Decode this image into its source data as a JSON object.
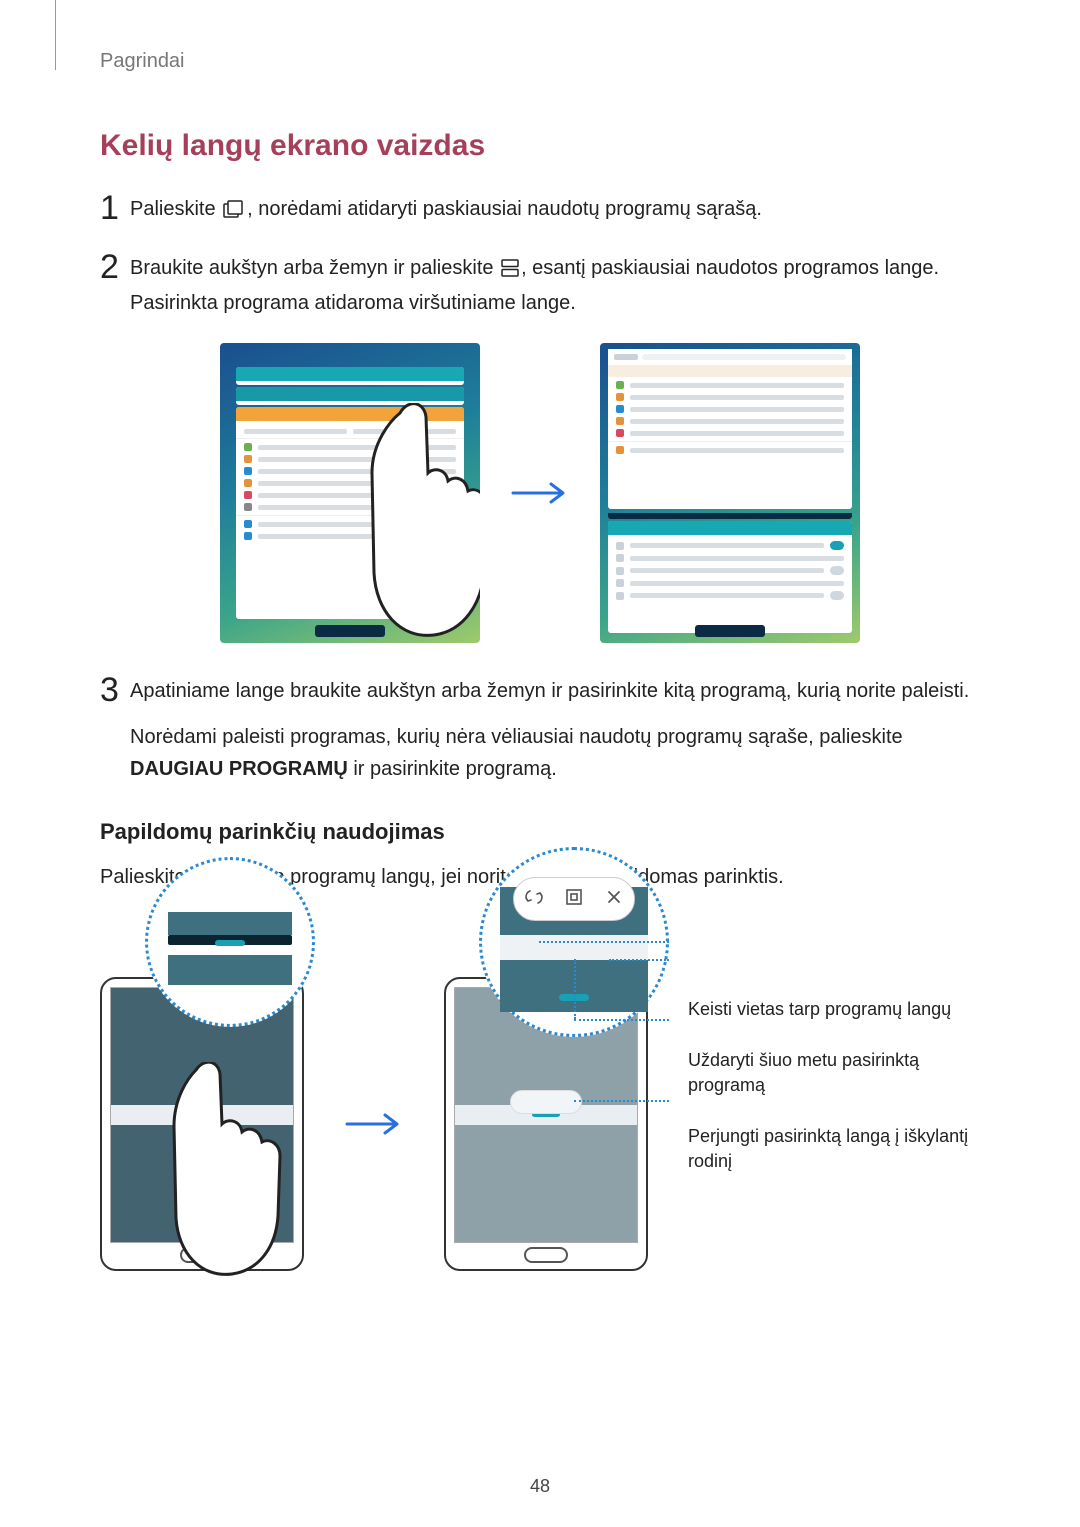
{
  "breadcrumb": "Pagrindai",
  "section_title": "Kelių langų ekrano vaizdas",
  "steps": [
    {
      "num": "1",
      "text_before": "Palieskite ",
      "icon": "recent-apps-icon",
      "text_after": ", norėdami atidaryti paskiausiai naudotų programų sąrašą."
    },
    {
      "num": "2",
      "text_before": "Braukite aukštyn arba žemyn ir palieskite ",
      "icon": "split-view-icon",
      "text_after": ", esantį paskiausiai naudotos programos lange. Pasirinkta programa atidaroma viršutiniame lange."
    },
    {
      "num": "3",
      "para1": "Apatiniame lange braukite aukštyn arba žemyn ir pasirinkite kitą programą, kurią norite paleisti.",
      "para2_before": "Norėdami paleisti programas, kurių nėra vėliausiai naudotų programų sąraše, palieskite ",
      "para2_bold": "DAUGIAU PROGRAMŲ",
      "para2_after": " ir pasirinkite programą."
    }
  ],
  "subsection_title": "Papildomų parinkčių naudojimas",
  "subsection_para": "Palieskite juostą tarp programų langų, jei norite pasiekti papildomas parinktis.",
  "callouts": {
    "swap": "Keisti vietas tarp programų langų",
    "close": "Uždaryti šiuo metu pasirinktą programą",
    "popup": "Perjungti pasirinktą langą į iškylantį rodinį"
  },
  "page_number": "48"
}
